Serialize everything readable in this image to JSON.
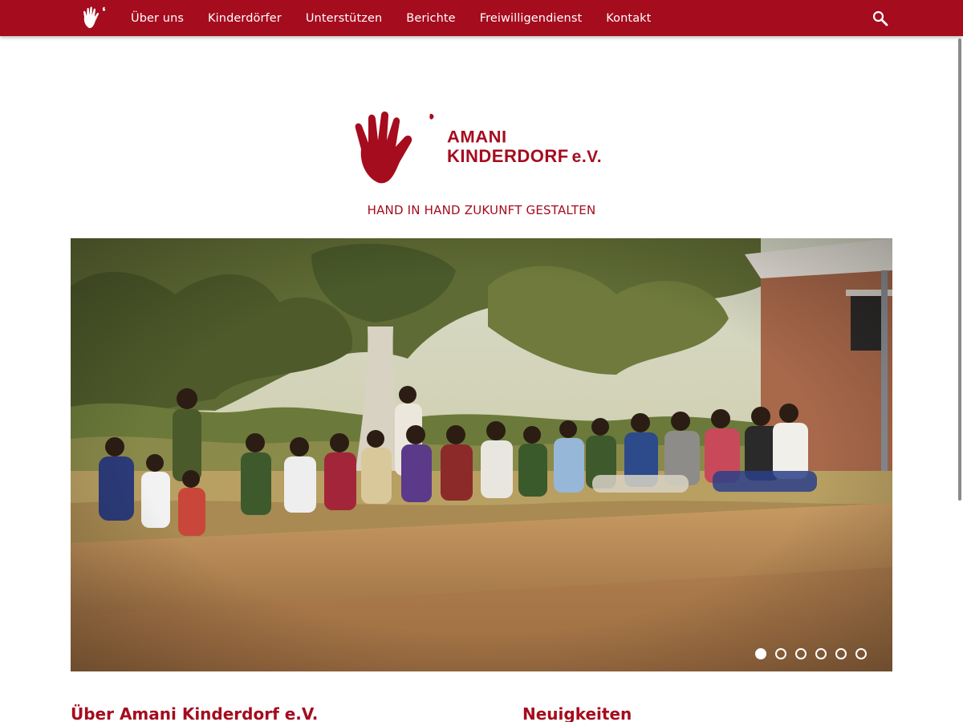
{
  "nav": {
    "logo_icon": "hand-logo-icon",
    "items": [
      {
        "label": "Über uns"
      },
      {
        "label": "Kinderdörfer"
      },
      {
        "label": "Unterstützen"
      },
      {
        "label": "Berichte"
      },
      {
        "label": "Freiwilligendienst"
      },
      {
        "label": "Kontakt"
      }
    ],
    "search_icon": "search-icon"
  },
  "logo": {
    "line1": "AMANI",
    "line2": "KINDERDORF",
    "suffix": "e.V."
  },
  "tagline": "HAND IN HAND ZUKUNFT GESTALTEN",
  "slider": {
    "image": "group photo of children and caregivers sitting on the ground outside a brick building",
    "slide_count": 6,
    "active_slide": 1
  },
  "sections": {
    "about_title": "Über Amani Kinderdorf e.V.",
    "news_title": "Neuigkeiten"
  },
  "colors": {
    "brand": "#a50c1e",
    "nav_text": "#ffffff"
  }
}
